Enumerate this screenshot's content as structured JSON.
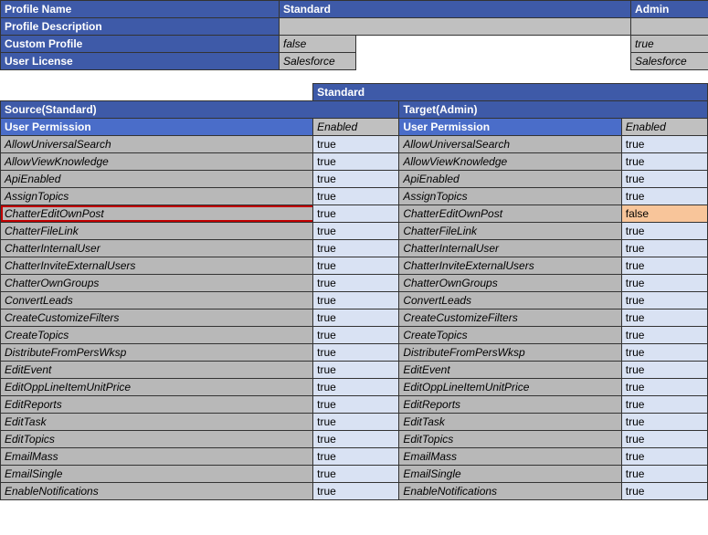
{
  "meta": {
    "profile_name_label": "Profile Name",
    "profile_desc_label": "Profile Description",
    "custom_profile_label": "Custom Profile",
    "user_license_label": "User License",
    "standard_label": "Standard",
    "admin_label": "Admin",
    "custom_profile_standard": "false",
    "custom_profile_admin": "true",
    "user_license_standard": "Salesforce",
    "user_license_admin": "Salesforce"
  },
  "section": {
    "group_header": "Standard",
    "source_header": "Source(Standard)",
    "target_header": "Target(Admin)",
    "user_permission_label": "User Permission",
    "enabled_label": "Enabled"
  },
  "rows": [
    {
      "name": "AllowUniversalSearch",
      "src": "true",
      "tgt": "true",
      "diff": false
    },
    {
      "name": "AllowViewKnowledge",
      "src": "true",
      "tgt": "true",
      "diff": false
    },
    {
      "name": "ApiEnabled",
      "src": "true",
      "tgt": "true",
      "diff": false
    },
    {
      "name": "AssignTopics",
      "src": "true",
      "tgt": "true",
      "diff": false
    },
    {
      "name": "ChatterEditOwnPost",
      "src": "true",
      "tgt": "false",
      "diff": true
    },
    {
      "name": "ChatterFileLink",
      "src": "true",
      "tgt": "true",
      "diff": false
    },
    {
      "name": "ChatterInternalUser",
      "src": "true",
      "tgt": "true",
      "diff": false
    },
    {
      "name": "ChatterInviteExternalUsers",
      "src": "true",
      "tgt": "true",
      "diff": false
    },
    {
      "name": "ChatterOwnGroups",
      "src": "true",
      "tgt": "true",
      "diff": false
    },
    {
      "name": "ConvertLeads",
      "src": "true",
      "tgt": "true",
      "diff": false
    },
    {
      "name": "CreateCustomizeFilters",
      "src": "true",
      "tgt": "true",
      "diff": false
    },
    {
      "name": "CreateTopics",
      "src": "true",
      "tgt": "true",
      "diff": false
    },
    {
      "name": "DistributeFromPersWksp",
      "src": "true",
      "tgt": "true",
      "diff": false
    },
    {
      "name": "EditEvent",
      "src": "true",
      "tgt": "true",
      "diff": false
    },
    {
      "name": "EditOppLineItemUnitPrice",
      "src": "true",
      "tgt": "true",
      "diff": false
    },
    {
      "name": "EditReports",
      "src": "true",
      "tgt": "true",
      "diff": false
    },
    {
      "name": "EditTask",
      "src": "true",
      "tgt": "true",
      "diff": false
    },
    {
      "name": "EditTopics",
      "src": "true",
      "tgt": "true",
      "diff": false
    },
    {
      "name": "EmailMass",
      "src": "true",
      "tgt": "true",
      "diff": false
    },
    {
      "name": "EmailSingle",
      "src": "true",
      "tgt": "true",
      "diff": false
    },
    {
      "name": "EnableNotifications",
      "src": "true",
      "tgt": "true",
      "diff": false
    }
  ]
}
